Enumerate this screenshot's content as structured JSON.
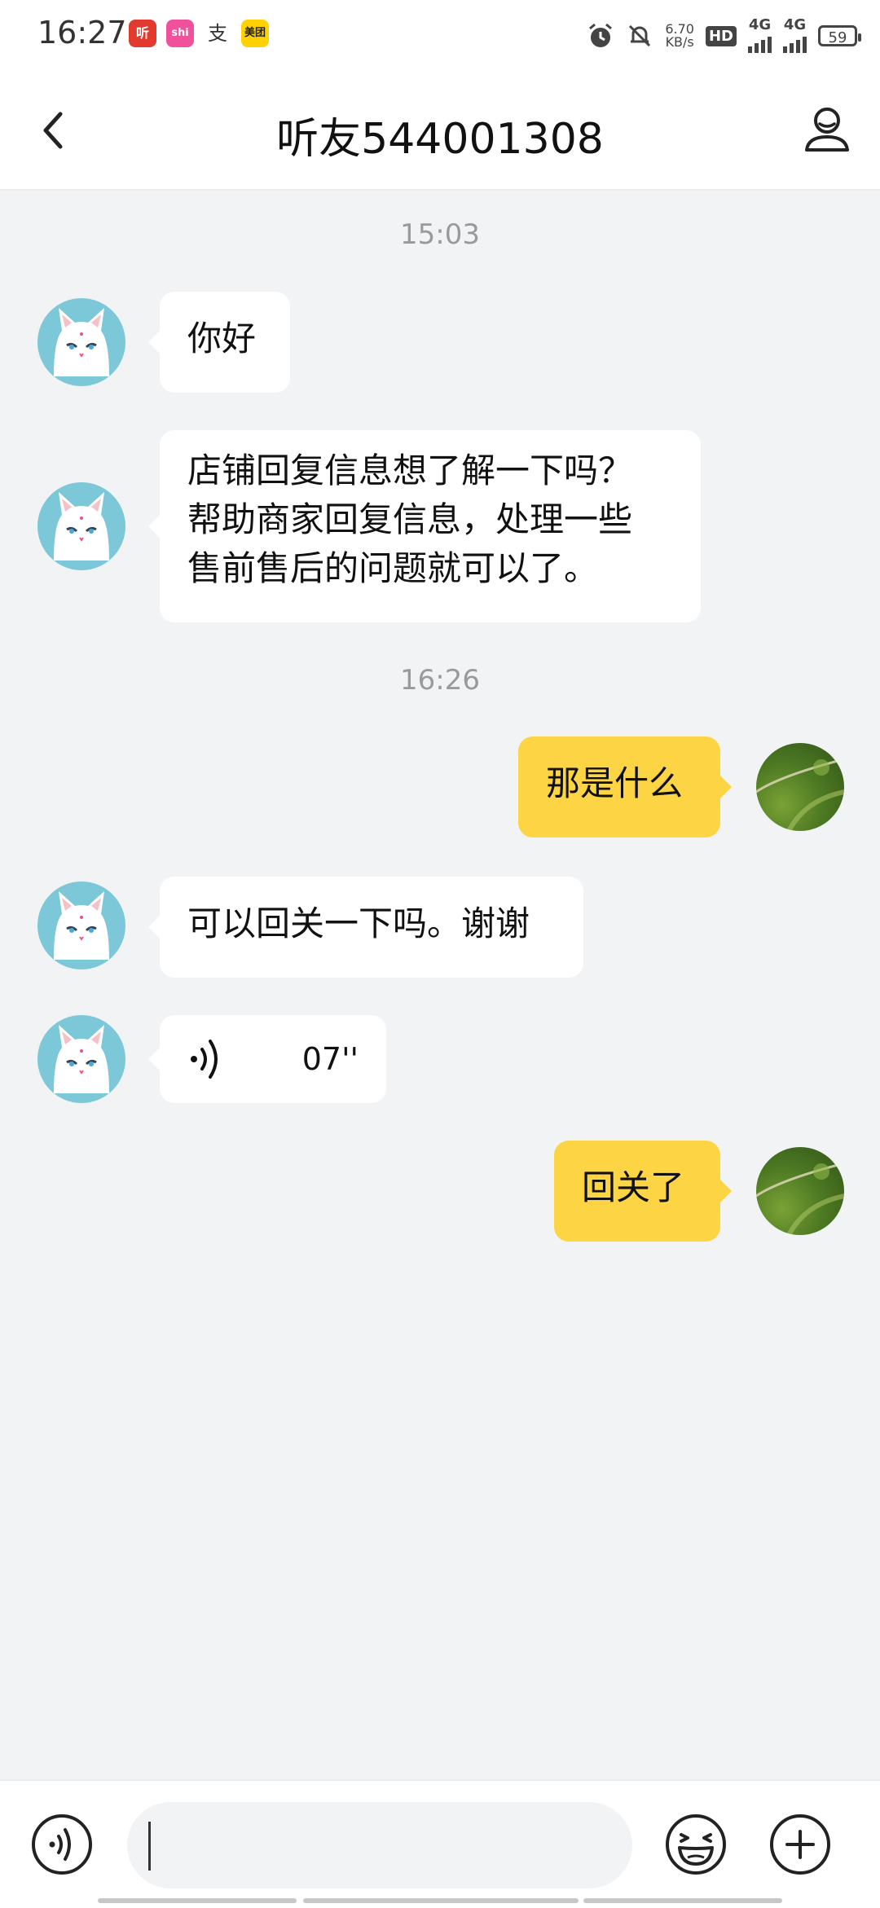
{
  "status_bar": {
    "time": "16:27",
    "apps": [
      {
        "name": "ting-app-icon",
        "label": "听",
        "color": "#E23A2E"
      },
      {
        "name": "shiguang-app-icon",
        "label": "shi",
        "color": "#F0519A"
      },
      {
        "name": "alipay-app-icon",
        "label": "支",
        "color": "#ffffff"
      },
      {
        "name": "meituan-app-icon",
        "label": "美团",
        "color": "#FFD100"
      }
    ],
    "speed_value": "6.70",
    "speed_unit": "KB/s",
    "hd_label": "HD",
    "network1": "4G",
    "network2": "4G",
    "battery": "59"
  },
  "header": {
    "title": "听友544001308"
  },
  "chat": {
    "timestamp1": "15:03",
    "msg1": "你好",
    "msg2_line1": "店铺回复信息想了解一下吗？",
    "msg2_line2": "帮助商家回复信息，处理一些",
    "msg2_line3": "售前售后的问题就可以了。",
    "timestamp2": "16:26",
    "msg3": "那是什么",
    "msg4": "可以回关一下吗。谢谢",
    "voice_duration": "07''",
    "msg5": "回关了"
  },
  "input": {
    "value": ""
  },
  "colors": {
    "outgoing_bubble": "#FDD444",
    "incoming_bubble": "#FFFFFF",
    "background": "#F2F3F5"
  }
}
